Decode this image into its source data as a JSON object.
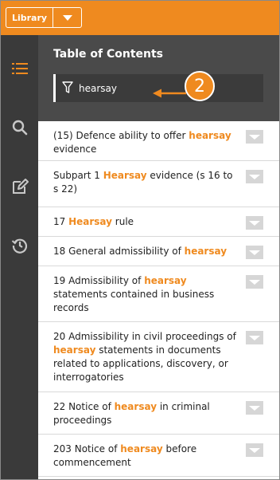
{
  "topbar": {
    "library_label": "Library"
  },
  "rail": [
    {
      "name": "toc-icon"
    },
    {
      "name": "search-icon"
    },
    {
      "name": "notes-icon"
    },
    {
      "name": "history-icon"
    }
  ],
  "toc": {
    "title": "Table of Contents",
    "filter_value": "hearsay",
    "callout_number": "2"
  },
  "rows": [
    {
      "parts": [
        {
          "t": "(15) Defence ability to offer "
        },
        {
          "t": "hearsay",
          "hl": true
        },
        {
          "t": " evidence"
        }
      ]
    },
    {
      "parts": [
        {
          "t": "Subpart 1 "
        },
        {
          "t": "Hearsay",
          "hl": true
        },
        {
          "t": " evidence (s 16 to s 22)"
        }
      ]
    },
    {
      "parts": [
        {
          "t": "17 "
        },
        {
          "t": "Hearsay",
          "hl": true
        },
        {
          "t": " rule"
        }
      ]
    },
    {
      "parts": [
        {
          "t": "18 General admissibility of "
        },
        {
          "t": "hearsay",
          "hl": true
        }
      ]
    },
    {
      "parts": [
        {
          "t": "19 Admissibility of "
        },
        {
          "t": "hearsay",
          "hl": true
        },
        {
          "t": " statements contained in business records"
        }
      ]
    },
    {
      "parts": [
        {
          "t": "20 Admissibility in civil proceedings of "
        },
        {
          "t": "hearsay",
          "hl": true
        },
        {
          "t": " statements in documents related to applications, discovery, or interrogatories"
        }
      ]
    },
    {
      "parts": [
        {
          "t": "22 Notice of "
        },
        {
          "t": "hearsay",
          "hl": true
        },
        {
          "t": " in criminal proceedings"
        }
      ]
    },
    {
      "parts": [
        {
          "t": "203 Notice of "
        },
        {
          "t": "hearsay",
          "hl": true
        },
        {
          "t": " before commencement"
        }
      ]
    }
  ],
  "colors": {
    "accent": "#ef8a1f",
    "rail": "#3a3a3a",
    "header": "#4a4a4a"
  }
}
